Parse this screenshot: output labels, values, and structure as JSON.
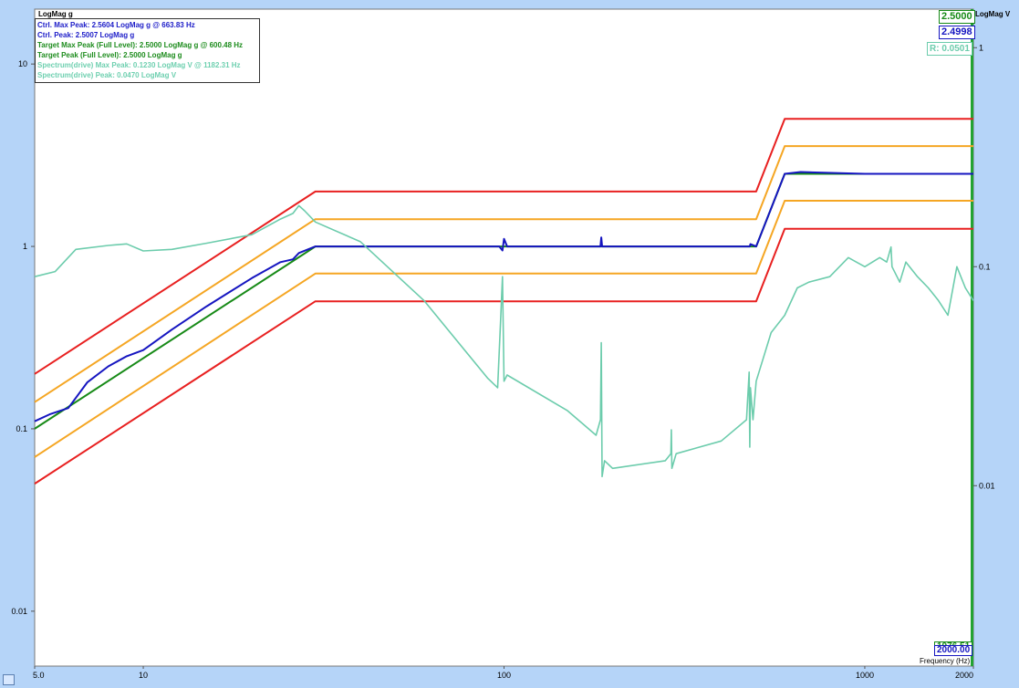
{
  "left_axis_title": "LogMag g",
  "right_axis_title": "LogMag V",
  "x_axis_title": "Frequency (Hz)",
  "legend": [
    {
      "text": "Ctrl. Max Peak: 2.5604 LogMag g @ 663.83 Hz",
      "color": "#1c1cc8"
    },
    {
      "text": "Ctrl. Peak: 2.5007 LogMag g",
      "color": "#1c1cc8"
    },
    {
      "text": "Target Max Peak (Full Level): 2.5000 LogMag g @ 600.48 Hz",
      "color": "#1d8c1d"
    },
    {
      "text": "Target Peak (Full Level): 2.5000 LogMag g",
      "color": "#1d8c1d"
    },
    {
      "text": "Spectrum(drive) Max Peak: 0.1230 LogMag V @ 1182.31 Hz",
      "color": "#6fd0b0"
    },
    {
      "text": "Spectrum(drive) Peak: 0.0470 LogMag V",
      "color": "#6fd0b0"
    }
  ],
  "readouts": {
    "target": "2.5000",
    "ctrl": "2.4998",
    "ratio": "R: 0.0501",
    "freq_top": "1976.51",
    "freq_bottom": "2000.00"
  },
  "colors": {
    "abort": "#e82020",
    "alarm": "#f5a623",
    "ctrl": "#1515c0",
    "target": "#178a17",
    "drive": "#6cccac",
    "frame": "#b5d4f8"
  },
  "chart_data": {
    "type": "line",
    "x_scale": "log",
    "y_scale": "log",
    "xlim": [
      5,
      2000
    ],
    "ylim": [
      0.005,
      20
    ],
    "y2lim": [
      0.0015,
      1.5
    ],
    "x_ticks": [
      "5.0",
      "10",
      "100",
      "1000",
      "2000"
    ],
    "x_tick_values": [
      5,
      10,
      100,
      1000,
      2000
    ],
    "y_ticks": [
      "10",
      "1",
      "0.1",
      "0.01"
    ],
    "y_tick_values": [
      10,
      1,
      0.1,
      0.01
    ],
    "y2_ticks": [
      "1",
      "0.1",
      "0.01"
    ],
    "y2_tick_values": [
      1,
      0.1,
      0.01
    ],
    "series": [
      {
        "key": "abort_high",
        "color": "#e82020",
        "x": [
          5,
          30,
          500,
          600,
          2000
        ],
        "y": [
          0.2,
          2.0,
          2.0,
          5.0,
          5.0
        ]
      },
      {
        "key": "alarm_high",
        "color": "#f5a623",
        "x": [
          5,
          30,
          500,
          600,
          2000
        ],
        "y": [
          0.14,
          1.41,
          1.41,
          3.55,
          3.55
        ]
      },
      {
        "key": "alarm_low",
        "color": "#f5a623",
        "x": [
          5,
          30,
          500,
          600,
          2000
        ],
        "y": [
          0.07,
          0.71,
          0.71,
          1.78,
          1.78
        ]
      },
      {
        "key": "abort_low",
        "color": "#e82020",
        "x": [
          5,
          30,
          500,
          600,
          2000
        ],
        "y": [
          0.05,
          0.5,
          0.5,
          1.25,
          1.25
        ]
      },
      {
        "key": "target",
        "color": "#178a17",
        "x": [
          5,
          30,
          500,
          600,
          2000
        ],
        "y": [
          0.1,
          1.0,
          1.0,
          2.5,
          2.5
        ]
      },
      {
        "key": "ctrl",
        "color": "#1515c0",
        "x": [
          5,
          5.5,
          6.2,
          7,
          8,
          9,
          10,
          12,
          15,
          20,
          24,
          26,
          27,
          30,
          50,
          97,
          99,
          100,
          102,
          185,
          186,
          187,
          300,
          480,
          482,
          500,
          600,
          663.83,
          1000,
          2000
        ],
        "y": [
          0.11,
          0.12,
          0.13,
          0.18,
          0.22,
          0.25,
          0.27,
          0.35,
          0.47,
          0.67,
          0.82,
          0.85,
          0.92,
          1.0,
          1.0,
          1.0,
          0.95,
          1.1,
          1.0,
          1.0,
          1.12,
          1.0,
          1.0,
          1.0,
          1.03,
          1.0,
          2.5,
          2.56,
          2.5,
          2.5
        ]
      },
      {
        "key": "drive",
        "axis": "right",
        "color": "#6cccac",
        "x": [
          5,
          5.7,
          6.5,
          8,
          9,
          10,
          12,
          15,
          20,
          24,
          26,
          27,
          28,
          30,
          40,
          60,
          90,
          96,
          98,
          99,
          100,
          102,
          150,
          180,
          185,
          186,
          187,
          190,
          200,
          280,
          290,
          291,
          292,
          300,
          400,
          470,
          478,
          480,
          482,
          490,
          500,
          550,
          600,
          650,
          700,
          800,
          900,
          1000,
          1100,
          1150,
          1182.31,
          1190,
          1250,
          1300,
          1400,
          1500,
          1600,
          1700,
          1800,
          1900,
          2000
        ],
        "y": [
          0.09,
          0.095,
          0.12,
          0.125,
          0.127,
          0.118,
          0.12,
          0.128,
          0.14,
          0.165,
          0.175,
          0.19,
          0.18,
          0.16,
          0.13,
          0.07,
          0.031,
          0.028,
          0.06,
          0.09,
          0.03,
          0.032,
          0.022,
          0.017,
          0.02,
          0.045,
          0.011,
          0.013,
          0.012,
          0.013,
          0.014,
          0.018,
          0.012,
          0.014,
          0.016,
          0.02,
          0.033,
          0.015,
          0.028,
          0.02,
          0.03,
          0.05,
          0.06,
          0.08,
          0.085,
          0.09,
          0.11,
          0.1,
          0.11,
          0.105,
          0.123,
          0.1,
          0.085,
          0.105,
          0.09,
          0.08,
          0.07,
          0.06,
          0.1,
          0.08,
          0.07
        ]
      }
    ]
  }
}
